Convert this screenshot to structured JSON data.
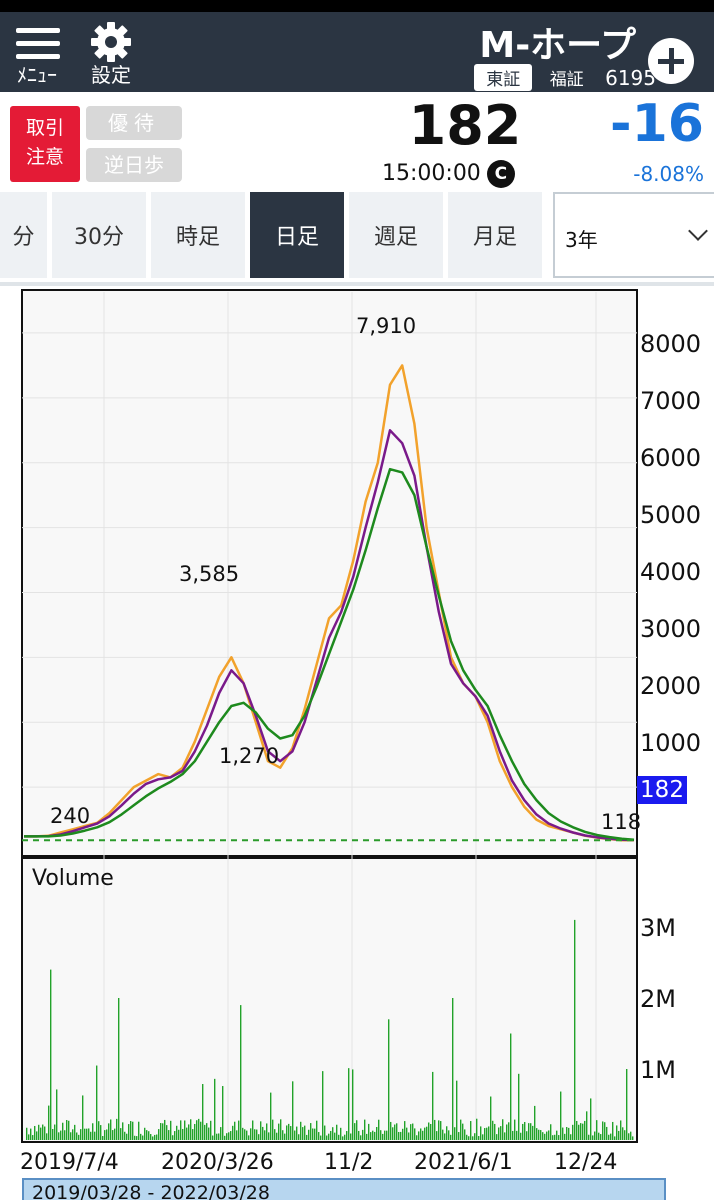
{
  "header": {
    "menu_label": "ﾒﾆｭｰ",
    "settings_label": "設定",
    "title": "M-ホープ",
    "market_primary": "東証",
    "market_secondary": "福証",
    "code": "6195"
  },
  "quote": {
    "warning_line1": "取引",
    "warning_line2": "注意",
    "benefit": "優待",
    "reverse_fee": "逆日歩",
    "price": "182",
    "time": "15:00:00",
    "time_badge": "C",
    "change": "-16",
    "change_pct": "-8.08%"
  },
  "tabs": {
    "items": [
      {
        "label": "分"
      },
      {
        "label": "30分"
      },
      {
        "label": "時足"
      },
      {
        "label": "日足",
        "active": true
      },
      {
        "label": "週足"
      },
      {
        "label": "月足"
      }
    ],
    "period_select": "3年"
  },
  "colors": {
    "header_bg": "#2b3542",
    "price_line": "#f2a22c",
    "candle_blue": "#7fa8d8",
    "ma_short": "#7a1a8a",
    "ma_long": "#1e8a1e",
    "volume": "#22a22a",
    "down_blue": "#1a73d9",
    "warning_red": "#e41b36"
  },
  "chart_data": {
    "type": "line",
    "title": "",
    "xlabel": "",
    "ylabel": "",
    "ylim": [
      0,
      8600
    ],
    "y_ticks": [
      "8000",
      "7000",
      "6000",
      "5000",
      "4000",
      "3000",
      "2000",
      "1000"
    ],
    "x_ticks": [
      "2019/7/4",
      "2020/3/26",
      "11/2",
      "2021/6/1",
      "12/24"
    ],
    "annotations": {
      "high": "7,910",
      "local_high": "3,585",
      "local_low": "1,270",
      "start_low": "240",
      "end_low": "118"
    },
    "last_price_label": "182",
    "last_price": 182,
    "series": [
      {
        "values": [
          240,
          240,
          250,
          300,
          350,
          400,
          450,
          600,
          800,
          1000,
          1100,
          1200,
          1150,
          1300,
          1700,
          2200,
          2700,
          3000,
          2600,
          2000,
          1400,
          1300,
          1600,
          2200,
          2900,
          3600,
          3800,
          4500,
          5400,
          6000,
          7200,
          7500,
          6600,
          5000,
          4000,
          3000,
          2600,
          2400,
          2000,
          1400,
          1000,
          700,
          500,
          400,
          350,
          300,
          250,
          220,
          200,
          180,
          182
        ]
      },
      {
        "values": [
          240,
          240,
          245,
          270,
          320,
          380,
          440,
          550,
          720,
          900,
          1050,
          1120,
          1150,
          1250,
          1550,
          1950,
          2450,
          2800,
          2600,
          2100,
          1550,
          1400,
          1550,
          2000,
          2650,
          3300,
          3700,
          4250,
          5000,
          5700,
          6500,
          6300,
          5800,
          4700,
          3700,
          2900,
          2600,
          2400,
          2100,
          1550,
          1100,
          800,
          580,
          440,
          360,
          300,
          255,
          225,
          205,
          190,
          185
        ]
      },
      {
        "values": [
          240,
          240,
          240,
          255,
          285,
          330,
          380,
          460,
          580,
          720,
          860,
          980,
          1080,
          1200,
          1400,
          1700,
          2000,
          2250,
          2300,
          2150,
          1900,
          1750,
          1800,
          2100,
          2550,
          3050,
          3550,
          4050,
          4650,
          5300,
          5900,
          5850,
          5500,
          4700,
          3950,
          3250,
          2800,
          2500,
          2250,
          1800,
          1400,
          1050,
          800,
          600,
          470,
          380,
          310,
          260,
          230,
          205,
          190
        ]
      }
    ],
    "volume": {
      "label": "Volume",
      "ylim": [
        0,
        4000000
      ],
      "y_ticks": [
        "3M",
        "2M",
        "1M"
      ]
    },
    "range_label": "2019/03/28 - 2022/03/28"
  }
}
